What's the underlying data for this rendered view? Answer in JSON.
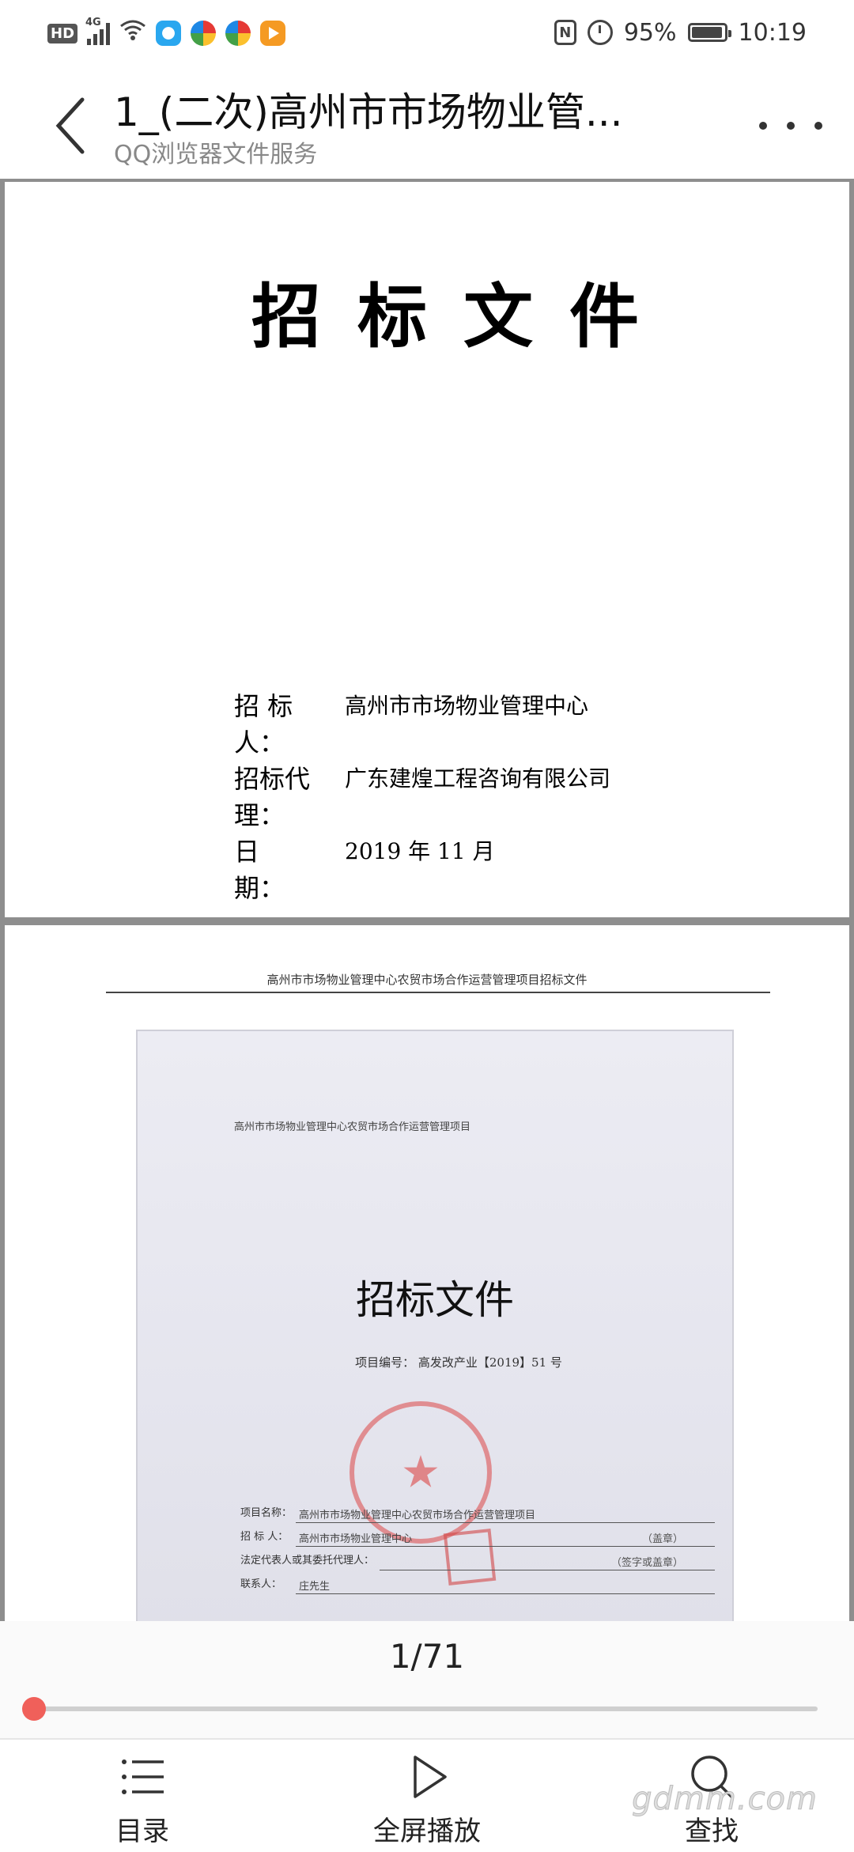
{
  "status_bar": {
    "hd": "HD",
    "network": "4G",
    "battery_percent": "95%",
    "battery_level": 0.95,
    "time": "10:19",
    "nfc": "N",
    "icons": [
      "hd-icon",
      "signal-icon",
      "wifi-icon",
      "qq-browser-icon",
      "color-app-icon",
      "color-app-icon",
      "video-play-icon",
      "nfc-icon",
      "alarm-icon",
      "battery-icon"
    ]
  },
  "header": {
    "title": "1_(二次)高州市市场物业管...",
    "subtitle": "QQ浏览器文件服务"
  },
  "page1": {
    "title": "招标文件",
    "info": [
      {
        "label": "招 标 人：",
        "value": "高州市市场物业管理中心"
      },
      {
        "label": "招标代理：",
        "value": "广东建煌工程咨询有限公司"
      },
      {
        "label": "日　　期：",
        "value": "2019 年  11 月"
      }
    ]
  },
  "page2": {
    "running_header": "高州市市场物业管理中心农贸市场合作运营管理项目招标文件",
    "photo": {
      "top_text": "高州市市场物业管理中心农贸市场合作运营管理项目",
      "title": "招标文件",
      "project_code": "项目编号：  高发改产业【2019】51 号",
      "fields": [
        {
          "label": "项目名称：",
          "value": "高州市市场物业管理中心农贸市场合作运营管理项目",
          "tail": ""
        },
        {
          "label": "招 标 人：",
          "value": "高州市市场物业管理中心",
          "tail": "（盖章）"
        },
        {
          "label": "法定代表人或其委托代理人：",
          "value": "",
          "tail": "（签字或盖章）"
        },
        {
          "label": "联系人：",
          "value": "庄先生",
          "tail": ""
        }
      ]
    }
  },
  "pager": {
    "page_label": "1/71",
    "current_page": 1,
    "total_pages": 71
  },
  "toolbar": {
    "menu_label": "目录",
    "play_label": "全屏播放",
    "find_label": "查找"
  },
  "watermark": "gdmm.com",
  "colors": {
    "accent": "#f0605a",
    "viewer_bg": "#8e8e8e",
    "seal": "#dc4646"
  }
}
